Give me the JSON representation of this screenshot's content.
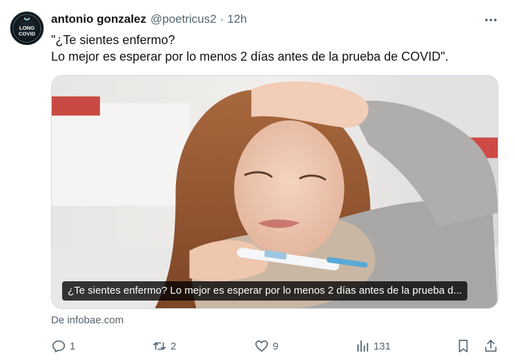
{
  "author": {
    "display_name": "antonio gonzalez",
    "handle": "@poetricus2",
    "separator": "·",
    "time": "12h",
    "avatar_text": {
      "top": "LONG",
      "bottom": "COVID"
    }
  },
  "tweet": {
    "lines": [
      "\"¿Te sientes enfermo?",
      "Lo mejor es esperar por lo menos 2 días antes de la prueba de COVID\"."
    ]
  },
  "media": {
    "caption": "¿Te sientes enfermo? Lo mejor es esperar por lo menos 2 días antes de la prueba d...",
    "source": "De infobae.com"
  },
  "actions": {
    "reply": {
      "icon": "reply-icon",
      "count": "1"
    },
    "retweet": {
      "icon": "retweet-icon",
      "count": "2"
    },
    "like": {
      "icon": "heart-icon",
      "count": "9"
    },
    "views": {
      "icon": "views-icon",
      "count": "131"
    },
    "bookmark": {
      "icon": "bookmark-icon"
    },
    "share": {
      "icon": "share-icon"
    }
  },
  "colors": {
    "text": "#0f1419",
    "secondary": "#536471",
    "border": "#cfd9de"
  }
}
